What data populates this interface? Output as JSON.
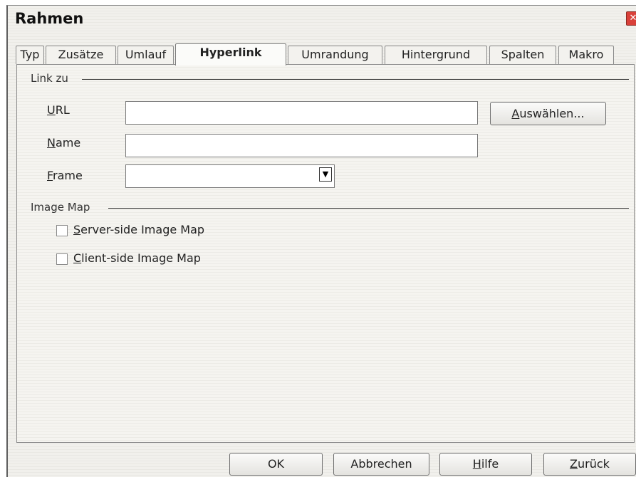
{
  "window": {
    "title": "Rahmen"
  },
  "tabs": [
    {
      "label": "Typ"
    },
    {
      "label": "Zusätze"
    },
    {
      "label": "Umlauf"
    },
    {
      "label": "Hyperlink",
      "active": true
    },
    {
      "label": "Umrandung"
    },
    {
      "label": "Hintergrund"
    },
    {
      "label": "Spalten"
    },
    {
      "label": "Makro"
    }
  ],
  "link_section": {
    "title": "Link zu",
    "url": {
      "label_mnemonic": "U",
      "label_rest": "RL",
      "value": ""
    },
    "name": {
      "label_mnemonic": "N",
      "label_rest": "ame",
      "value": ""
    },
    "frame": {
      "label_mnemonic": "F",
      "label_rest": "rame",
      "value": ""
    },
    "browse_button": {
      "mnemonic": "A",
      "rest": "uswählen..."
    }
  },
  "image_map_section": {
    "title": "Image Map",
    "server_side": {
      "mnemonic": "S",
      "rest": "erver-side Image Map",
      "checked": false
    },
    "client_side": {
      "mnemonic": "C",
      "rest": "lient-side Image Map",
      "checked": false
    }
  },
  "footer": {
    "ok_label": "OK",
    "cancel_label": "Abbrechen",
    "help": {
      "mnemonic": "H",
      "rest": "ilfe"
    },
    "reset": {
      "mnemonic": "Z",
      "rest": "urück"
    }
  },
  "colors": {
    "close_button": "#d9413a",
    "panel_bg": "#f5f4f0"
  }
}
